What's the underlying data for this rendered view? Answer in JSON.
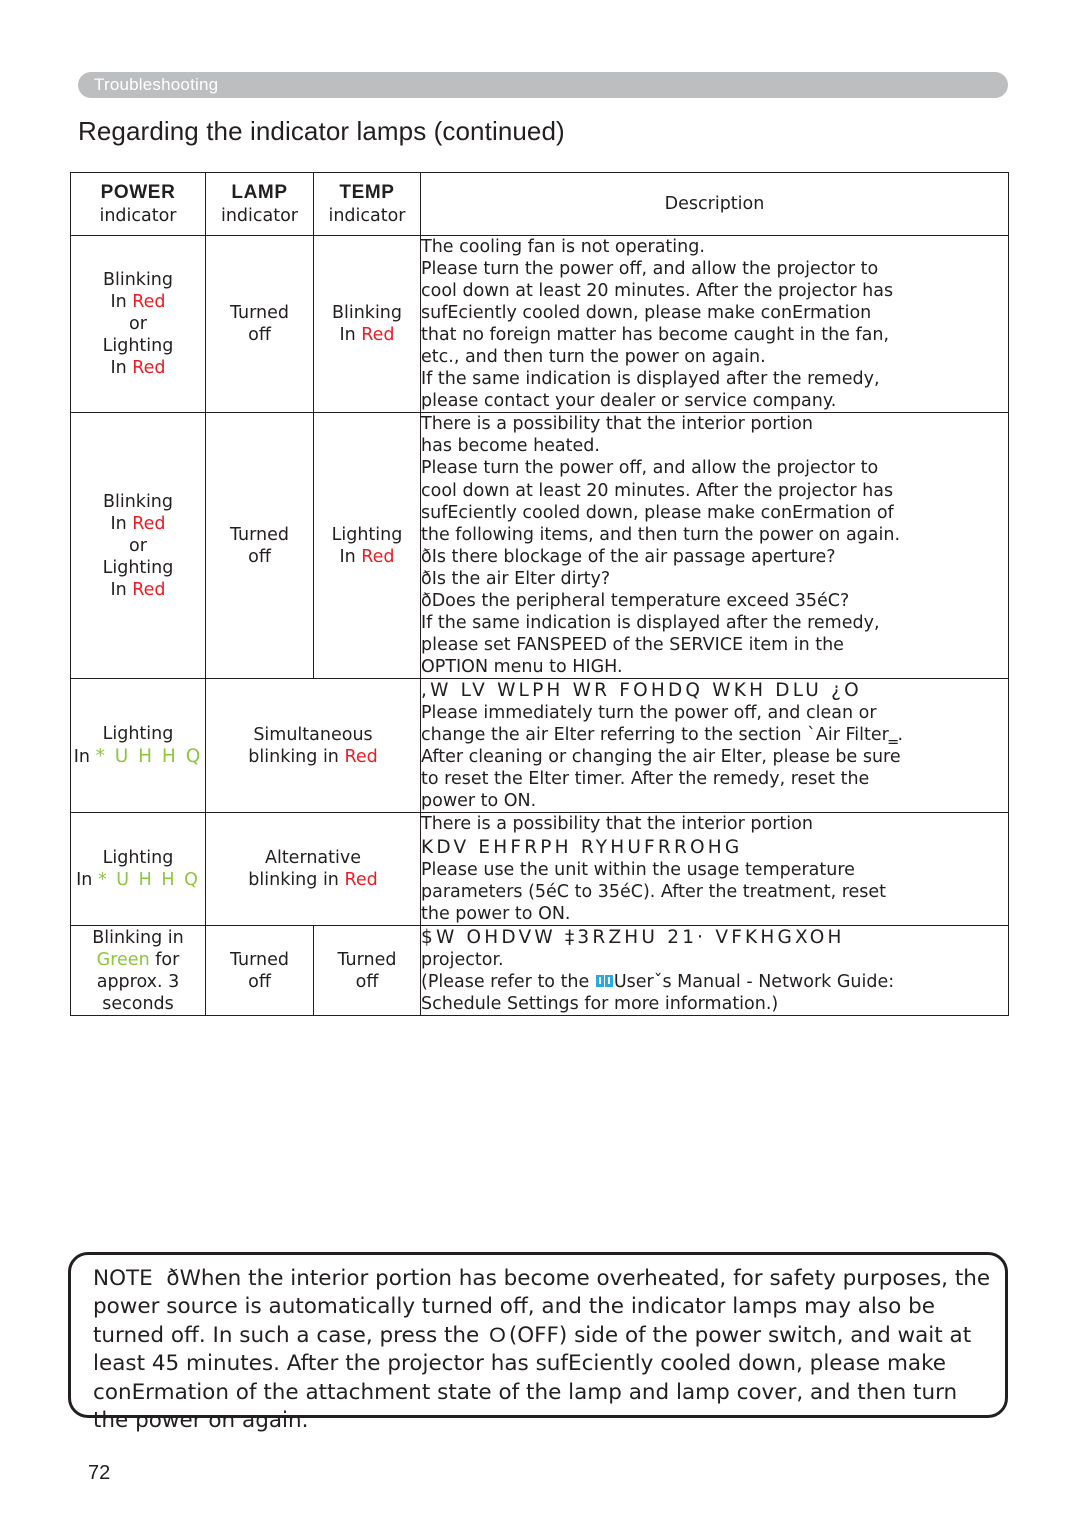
{
  "running_head": {
    "label": "Troubleshooting"
  },
  "page_title": "Regarding the indicator lamps (continued)",
  "folio": "72",
  "colors": {
    "red": "#ed1c24",
    "green": "#8dc63f",
    "runhead_bg": "#bcbec0",
    "badge_shadow": "#c9cbcd",
    "book_icon": "#29abe2",
    "text": "#231f20"
  },
  "table": {
    "headers": {
      "power": {
        "badge": "POWER",
        "sub": "indicator"
      },
      "lamp": {
        "badge": "LAMP",
        "sub": "indicator"
      },
      "temp": {
        "badge": "TEMP",
        "sub": "indicator"
      },
      "description": "Description"
    },
    "rows": [
      {
        "power": {
          "line1": "Blinking",
          "line2_pre": "In ",
          "line2_color": "Red",
          "line3": "or",
          "line4": "Lighting",
          "line5_pre": "In ",
          "line5_color": "Red"
        },
        "lamp": {
          "line1": "Turned",
          "line2": "off"
        },
        "temp": {
          "line1": "Blinking",
          "line2_pre": "In ",
          "line2_color": "Red"
        },
        "description": [
          "The cooling fan is not operating.",
          "Please turn the power off, and allow the projector to",
          "cool down at least 20 minutes. After the projector has",
          "sufEciently cooled down, please make conErmation",
          "that no foreign matter has become caught in the fan,",
          "etc., and then turn the power on again.",
          "If the same indication is displayed after the remedy,",
          "please contact your dealer or service company."
        ]
      },
      {
        "power": {
          "line1": "Blinking",
          "line2_pre": "In ",
          "line2_color": "Red",
          "line3": "or",
          "line4": "Lighting",
          "line5_pre": "In ",
          "line5_color": "Red"
        },
        "lamp": {
          "line1": "Turned",
          "line2": "off"
        },
        "temp": {
          "line1": "Lighting",
          "line2_pre": "In ",
          "line2_color": "Red"
        },
        "description": [
          "There is a possibility that the interior portion",
          "has become heated.",
          "Please turn the power off, and allow the projector to",
          "cool down at least 20 minutes. After the projector has",
          "sufEciently cooled down, please make conErmation of",
          "the following items, and then turn the power on again.",
          "ðIs there blockage of the air passage aperture?",
          "ðIs the air Elter dirty?",
          "ðDoes the peripheral temperature exceed 35éC?",
          "If the same indication is displayed after the remedy,",
          "please set FANSPEED of the SERVICE item in the",
          "OPTION menu to HIGH."
        ]
      },
      {
        "power": {
          "line1": "Lighting",
          "line2_pre": "In ",
          "line2_color": "* U H H Q"
        },
        "lamp_temp_merged": {
          "line1": "Simultaneous",
          "line2_pre": "blinking in ",
          "line2_color": "Red"
        },
        "description_garbled": ",W LV WLPH WR FOHDQ WKH DLU ¿O",
        "description": [
          "Please immediately turn the power off, and clean or",
          "change the air Elter referring to the section `Air Filter‗.",
          "After cleaning or changing the air Elter, please be sure",
          "to reset the Elter timer. After the remedy, reset the",
          "power to ON."
        ]
      },
      {
        "power": {
          "line1": "Lighting",
          "line2_pre": "In ",
          "line2_color": "* U H H Q"
        },
        "lamp_temp_merged": {
          "line1": "Alternative",
          "line2_pre": "blinking in ",
          "line2_color": "Red"
        },
        "description_first": "There is a possibility that the interior portion",
        "description_garbled": "KDV EHFRPH RYHUFRROHG",
        "description": [
          "Please use the unit within the usage temperature",
          "parameters (5éC to 35éC). After the treatment, reset",
          "the power to ON."
        ]
      },
      {
        "power": {
          "line1": "Blinking in",
          "line2_color": "Green",
          "line2_post": " for",
          "line3": "approx. 3",
          "line4": "seconds"
        },
        "lamp": {
          "line1": "Turned",
          "line2": "off"
        },
        "temp": {
          "line1": "Turned",
          "line2": "off"
        },
        "description_garbled": "$W OHDVW  ‡3RZHU 21· VFKHGXOH",
        "description": [
          "projector.",
          "(Please refer to the ",
          "Userˇs Manual - Network Guide:",
          "Schedule Settings for more information.)"
        ]
      }
    ]
  },
  "note": {
    "label": "NOTE",
    "bullet": "ð",
    "text_1": "When the interior portion has become overheated, for safety purposes, the power source is automatically turned off, and the indicator lamps may also be turned off. In such a case, press the ",
    "key_glyph": "O",
    "text_2": "(OFF) side of the power switch, and wait at least 45 minutes. After the projector has sufEciently cooled down, please make conErmation of the attachment state of the lamp and lamp cover, and then turn the power on again."
  }
}
